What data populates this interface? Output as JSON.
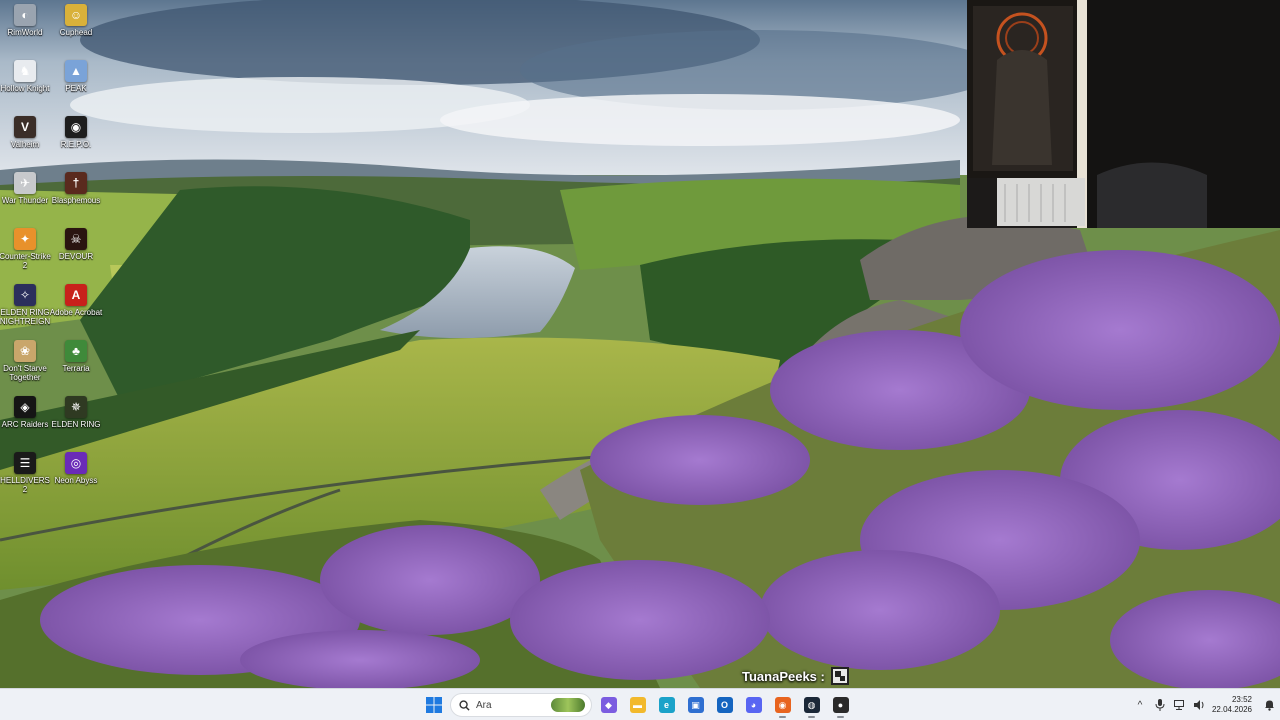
{
  "desktop": {
    "icons": [
      {
        "label": "RimWorld",
        "icon": "rimworld-icon",
        "color": "#9aa4b0",
        "glyph": "◐"
      },
      {
        "label": "Cuphead",
        "icon": "cuphead-icon",
        "color": "#d9b13a",
        "glyph": "☺"
      },
      {
        "label": "Hollow Knight",
        "icon": "hollow-knight-icon",
        "color": "#e8ebef",
        "glyph": "♞"
      },
      {
        "label": "PEAK",
        "icon": "peak-icon",
        "color": "#7aa3d8",
        "glyph": "▲"
      },
      {
        "label": "Valheim",
        "icon": "valheim-icon",
        "color": "#3b2e28",
        "glyph": "V"
      },
      {
        "label": "R.E.P.O.",
        "icon": "repo-icon",
        "color": "#1e1e1e",
        "glyph": "◉"
      },
      {
        "label": "War Thunder",
        "icon": "war-thunder-icon",
        "color": "#c7c9cc",
        "glyph": "✈"
      },
      {
        "label": "Blasphemous",
        "icon": "blasphemous-icon",
        "color": "#5a2a1e",
        "glyph": "†"
      },
      {
        "label": "Counter-Strike 2",
        "icon": "counter-strike-icon",
        "color": "#e8912b",
        "glyph": "✦"
      },
      {
        "label": "DEVOUR",
        "icon": "devour-icon",
        "color": "#2a1410",
        "glyph": "☠"
      },
      {
        "label": "ELDEN RING NIGHTREIGN",
        "icon": "elden-ring-nightreign-icon",
        "color": "#2b2f5c",
        "glyph": "✧"
      },
      {
        "label": "Adobe Acrobat",
        "icon": "adobe-acrobat-icon",
        "color": "#c8211b",
        "glyph": "A"
      },
      {
        "label": "Don't Starve Together",
        "icon": "dont-starve-icon",
        "color": "#c9a66b",
        "glyph": "❀"
      },
      {
        "label": "Terraria",
        "icon": "terraria-icon",
        "color": "#3f8a3a",
        "glyph": "♣"
      },
      {
        "label": "ARC Raiders",
        "icon": "arc-raiders-icon",
        "color": "#151515",
        "glyph": "◈"
      },
      {
        "label": "ELDEN RING",
        "icon": "elden-ring-icon",
        "color": "#2f3a22",
        "glyph": "✵"
      },
      {
        "label": "HELLDIVERS 2",
        "icon": "helldivers-icon",
        "color": "#1a1a1a",
        "glyph": "☰"
      },
      {
        "label": "Neon Abyss",
        "icon": "neon-abyss-icon",
        "color": "#6a2bb8",
        "glyph": "◎"
      }
    ]
  },
  "stream": {
    "name": "TuanaPeeks :"
  },
  "taskbar": {
    "search_placeholder": "Ara",
    "apps": [
      {
        "name": "taskbar-start",
        "icon": "windows-start-icon",
        "color": "#1f7ae0",
        "glyph": "⊞",
        "active": false
      },
      {
        "name": "taskbar-widgets",
        "icon": "copilot-icon",
        "color": "#7b5ce0",
        "glyph": "◆",
        "active": false
      },
      {
        "name": "taskbar-file-explorer",
        "icon": "folder-icon",
        "color": "#f2b92c",
        "glyph": "▬",
        "active": false
      },
      {
        "name": "taskbar-edge",
        "icon": "edge-icon",
        "color": "#1ba2c9",
        "glyph": "e",
        "active": false
      },
      {
        "name": "taskbar-store",
        "icon": "store-icon",
        "color": "#2f6fd1",
        "glyph": "▣",
        "active": false
      },
      {
        "name": "taskbar-outlook",
        "icon": "outlook-icon",
        "color": "#1565c0",
        "glyph": "O",
        "active": false
      },
      {
        "name": "taskbar-discord",
        "icon": "discord-icon",
        "color": "#5865f2",
        "glyph": "◕",
        "active": false
      },
      {
        "name": "taskbar-firefox",
        "icon": "firefox-icon",
        "color": "#e8641f",
        "glyph": "◉",
        "active": true
      },
      {
        "name": "taskbar-steam",
        "icon": "steam-icon",
        "color": "#1b2838",
        "glyph": "◍",
        "active": true
      },
      {
        "name": "taskbar-obs",
        "icon": "obs-icon",
        "color": "#2a2a2a",
        "glyph": "●",
        "active": true
      }
    ],
    "tray": {
      "time": "23:52",
      "date": "22.04.2026"
    }
  },
  "colors": {
    "taskbar_bg": "#eef1f6",
    "accent": "#1f7ae0"
  }
}
